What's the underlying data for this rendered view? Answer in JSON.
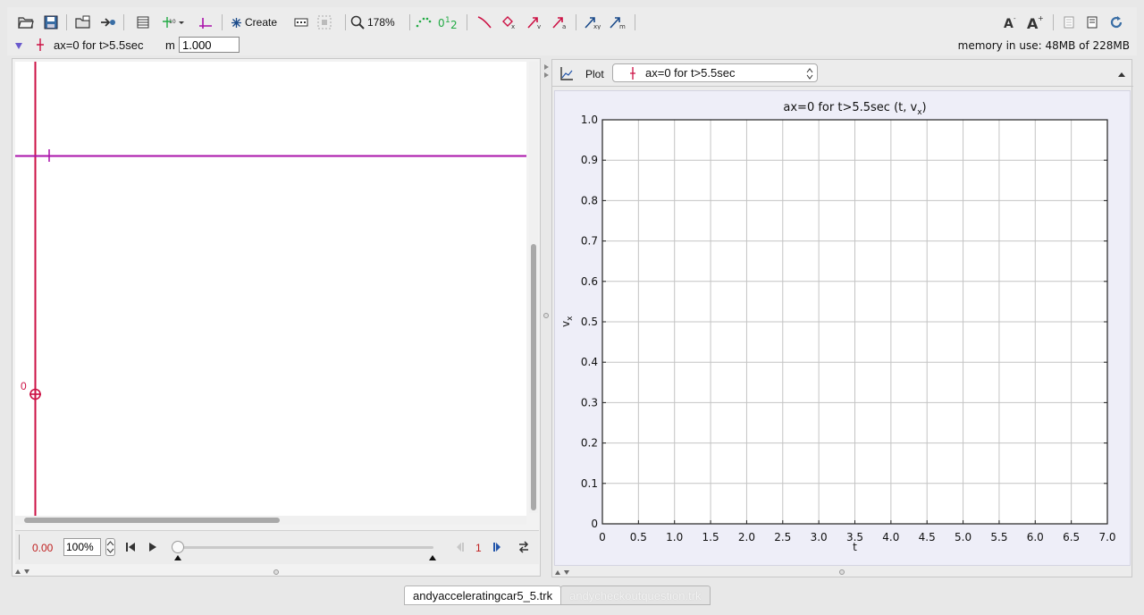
{
  "toolbar": {
    "create_label": "Create",
    "zoom_label": "178%"
  },
  "trackbar": {
    "track_name": "ax=0 for t>5.5sec",
    "mass_label": "m",
    "mass_value": "1.000",
    "memory_label": "memory in use: 48MB of 228MB"
  },
  "video": {
    "origin_label": "0",
    "time_readout": "0.00",
    "rate_value": "100%",
    "step_value": "1"
  },
  "plot_panel": {
    "plot_button_label": "Plot",
    "track_select_value": "ax=0 for t>5.5sec"
  },
  "chart_data": {
    "type": "line",
    "title_prefix": "ax=0  for t>5.5sec (t, v",
    "title_sub": "x",
    "title_suffix": ")",
    "xlabel": "t",
    "ylabel": "v",
    "ylabel_sub": "x",
    "xlim": [
      0,
      7.0
    ],
    "ylim": [
      0,
      1.0
    ],
    "xticks": [
      "0",
      "0.5",
      "1.0",
      "1.5",
      "2.0",
      "2.5",
      "3.0",
      "3.5",
      "4.0",
      "4.5",
      "5.0",
      "5.5",
      "6.0",
      "6.5",
      "7.0"
    ],
    "yticks": [
      "0",
      "0.1",
      "0.2",
      "0.3",
      "0.4",
      "0.5",
      "0.6",
      "0.7",
      "0.8",
      "0.9",
      "1.0"
    ],
    "grid": true,
    "series": []
  },
  "tabs": [
    {
      "label": "andyacceleratingcar5_5.trk",
      "active": true
    },
    {
      "label": "andycheckoutquestion.trk",
      "active": false
    }
  ],
  "colors": {
    "track": "#cc1144",
    "axes": "#aa11aa",
    "plot_bg": "#eeeef8",
    "accent_green": "#22aa44"
  }
}
